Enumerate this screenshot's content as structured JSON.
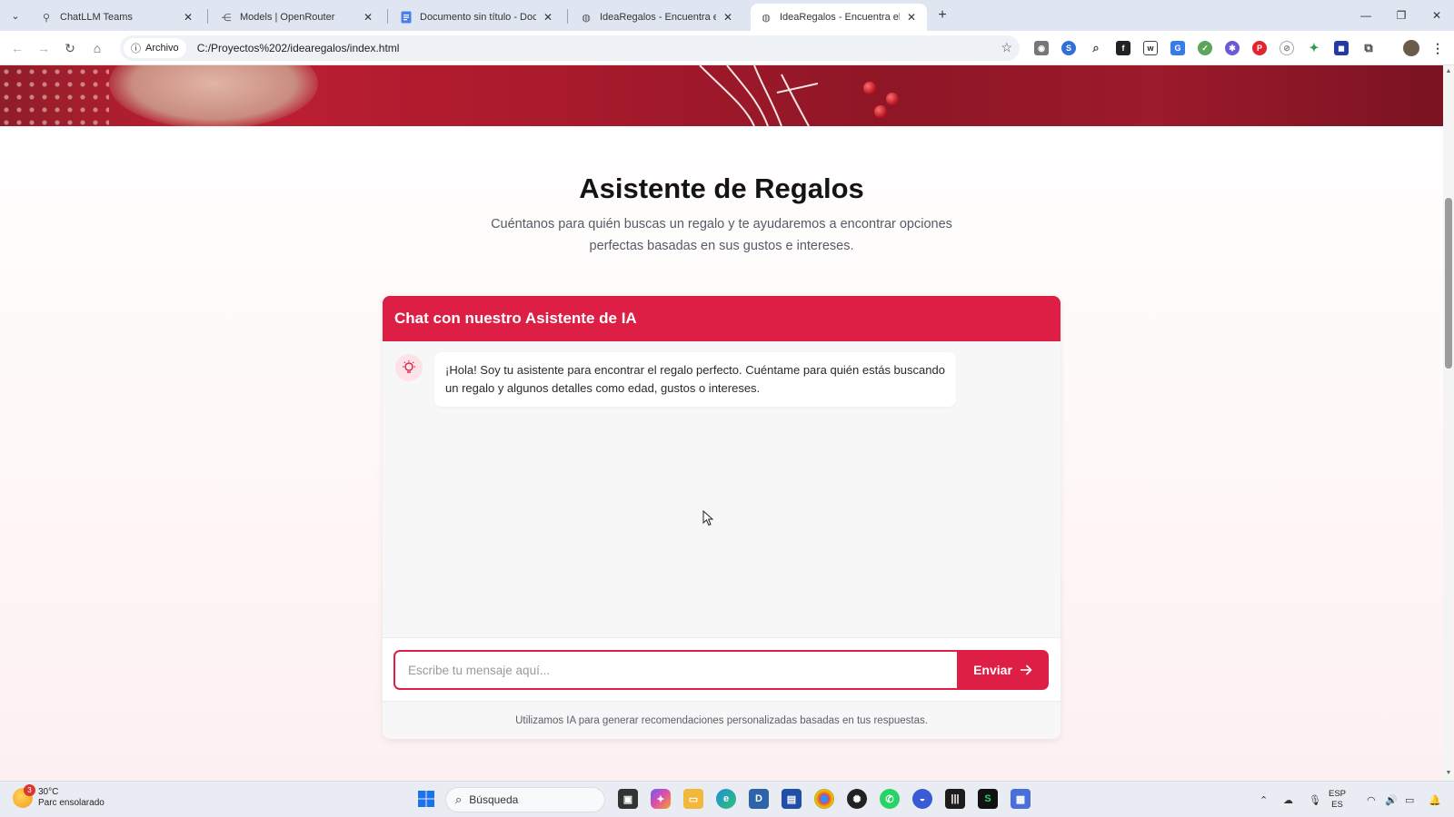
{
  "browser": {
    "tabs": [
      {
        "title": "ChatLLM Teams",
        "icon": "chatllm-icon",
        "active": false
      },
      {
        "title": "Models | OpenRouter",
        "icon": "openrouter-icon",
        "active": false
      },
      {
        "title": "Documento sin título - Docume",
        "icon": "docs-icon",
        "active": false
      },
      {
        "title": "IdeaRegalos - Encuentra el Reg",
        "icon": "globe-icon",
        "active": false
      },
      {
        "title": "IdeaRegalos - Encuentra el Reg",
        "icon": "globe-icon",
        "active": true
      }
    ],
    "site_chip": "Archivo",
    "url": "C:/Proyectos%202/idearegalos/index.html"
  },
  "page": {
    "title": "Asistente de Regalos",
    "subtitle": "Cuéntanos para quién buscas un regalo y te ayudaremos a encontrar opciones perfectas basadas en sus gustos e intereses.",
    "chat": {
      "header": "Chat con nuestro Asistente de IA",
      "messages": [
        {
          "sender": "bot",
          "text": "¡Hola! Soy tu asistente para encontrar el regalo perfecto. Cuéntame para quién estás buscando un regalo y algunos detalles como edad, gustos o intereses."
        }
      ],
      "input_placeholder": "Escribe tu mensaje aquí...",
      "input_value": "",
      "send_label": "Enviar",
      "footer_note": "Utilizamos IA para generar recomendaciones personalizadas basadas en tus respuestas."
    },
    "accent_color": "#dd1f45"
  },
  "taskbar": {
    "weather_temp": "30°C",
    "weather_desc": "Parc ensolarado",
    "weather_badge": "3",
    "search_label": "Búsqueda",
    "lang_line1": "ESP",
    "lang_line2": "ES"
  }
}
